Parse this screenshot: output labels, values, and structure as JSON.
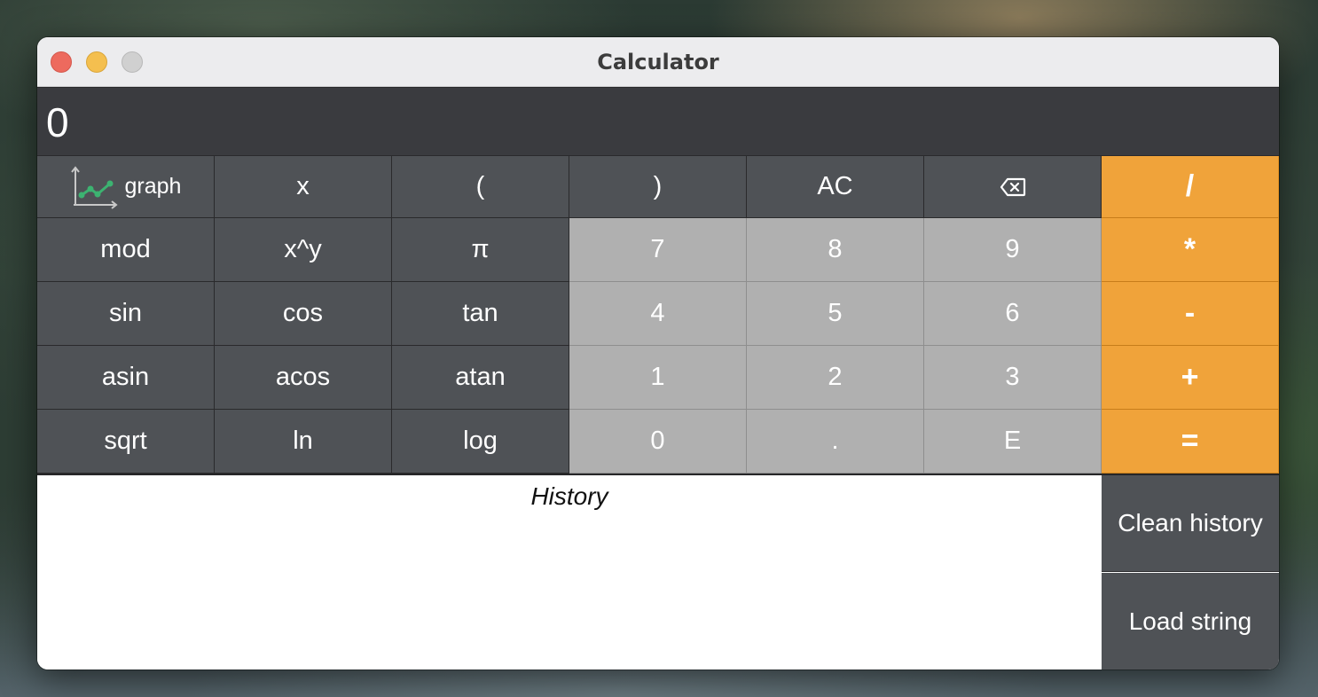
{
  "window": {
    "title": "Calculator"
  },
  "display": {
    "value": "0"
  },
  "keys": {
    "graph": "graph",
    "var_x": "x",
    "lparen": "(",
    "rparen": ")",
    "ac": "AC",
    "divide": "/",
    "mod": "mod",
    "pow": "x^y",
    "pi": "π",
    "d7": "7",
    "d8": "8",
    "d9": "9",
    "multiply": "*",
    "sin": "sin",
    "cos": "cos",
    "tan": "tan",
    "d4": "4",
    "d5": "5",
    "d6": "6",
    "minus": "-",
    "asin": "asin",
    "acos": "acos",
    "atan": "atan",
    "d1": "1",
    "d2": "2",
    "d3": "3",
    "plus": "+",
    "sqrt": "sqrt",
    "ln": "ln",
    "log": "log",
    "d0": "0",
    "dot": ".",
    "exp": "E",
    "equals": "="
  },
  "history": {
    "title": "History"
  },
  "side_buttons": {
    "clean": "Clean history",
    "load": "Load string"
  },
  "icons": {
    "graph": "line-chart-icon",
    "backspace": "backspace-icon"
  },
  "colors": {
    "operator": "#f0a33a",
    "function_key": "#4f5256",
    "digit_key": "#b0b0b0",
    "display_bg": "#3a3b3f",
    "graph_line": "#3cb371"
  }
}
